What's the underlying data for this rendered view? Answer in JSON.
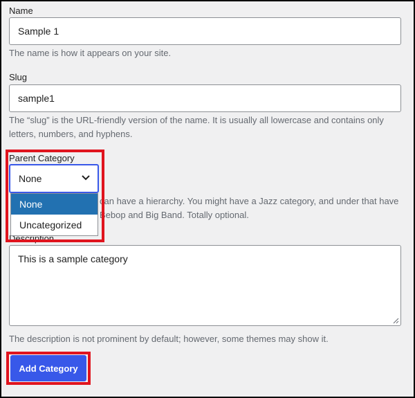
{
  "form": {
    "name": {
      "label": "Name",
      "value": "Sample 1",
      "help": "The name is how it appears on your site."
    },
    "slug": {
      "label": "Slug",
      "value": "sample1",
      "help": "The “slug” is the URL-friendly version of the name. It is usually all lowercase and contains only letters, numbers, and hyphens."
    },
    "parent": {
      "label": "Parent Category",
      "selected": "None",
      "options": [
        "None",
        "Uncategorized"
      ],
      "help_line1": "can have a hierarchy. You might have a Jazz category, and under that have",
      "help_line2": "Bebop and Big Band. Totally optional."
    },
    "description": {
      "label": "Description",
      "value": "This is a sample category",
      "help": "The description is not prominent by default; however, some themes may show it."
    },
    "submit_label": "Add Category"
  },
  "icons": {
    "select_chevron": "chevron-down-icon",
    "textarea_grip": "resize-grip-icon"
  },
  "colors": {
    "accent": "#3858e9",
    "option_highlight": "#2271b1",
    "annotation_red": "#e0141e"
  }
}
